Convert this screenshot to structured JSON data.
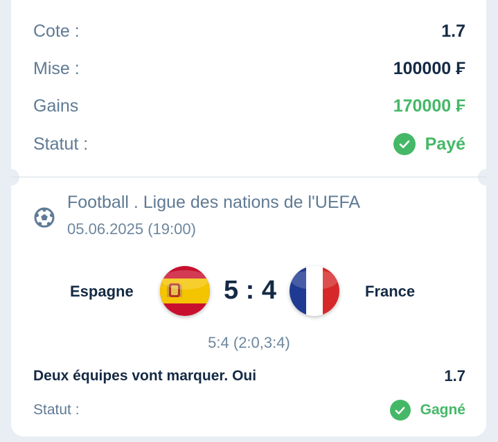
{
  "summary": {
    "rows": [
      {
        "label": "Cote :",
        "value": "1.7"
      },
      {
        "label": "Mise :",
        "value": "100000 ₣"
      },
      {
        "label": "Gains",
        "value": "170000 ₣"
      }
    ],
    "status_label": "Statut :",
    "status_value": "Payé"
  },
  "event": {
    "title": "Football . Ligue des nations de l'UEFA",
    "date": "05.06.2025 (19:00)",
    "home_team": "Espagne",
    "away_team": "France",
    "score": "5 : 4",
    "score_detail": "5:4 (2:0,3:4)"
  },
  "bet": {
    "name": "Deux équipes vont marquer. Oui",
    "odd": "1.7",
    "status_label": "Statut :",
    "status_value": "Gagné"
  },
  "colors": {
    "label": "#5f7a94",
    "value": "#142a44",
    "success": "#45b867",
    "background": "#e9eef4"
  },
  "icons": [
    "check-circle-icon",
    "soccer-ball-icon",
    "spain-flag-icon",
    "france-flag-icon"
  ]
}
